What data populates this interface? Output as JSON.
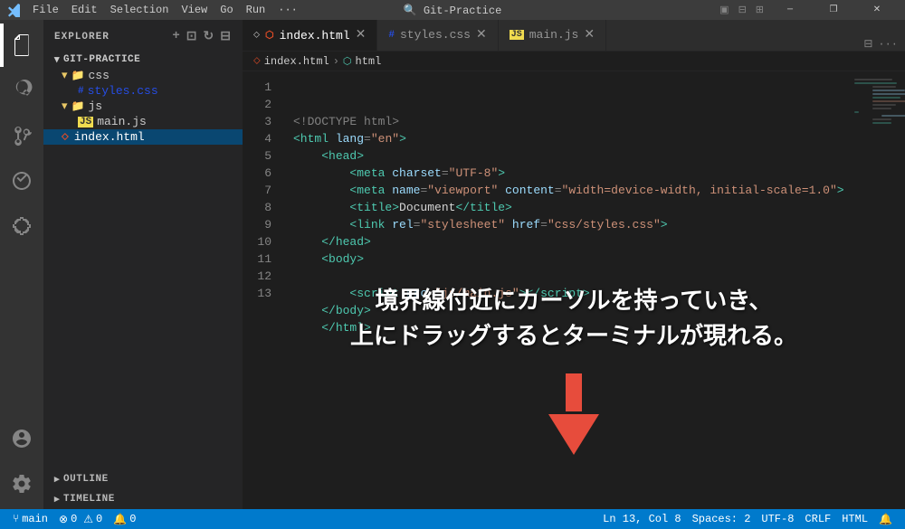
{
  "titlebar": {
    "menu_items": [
      "File",
      "Edit",
      "Selection",
      "View",
      "Go",
      "Run"
    ],
    "more": "···",
    "title": "Git-Practice",
    "search_placeholder": "Git-Practice",
    "btn_minimize": "─",
    "btn_maximize": "□",
    "btn_restore": "❐",
    "btn_close": "✕"
  },
  "activity_bar": {
    "icons": [
      {
        "name": "explorer-icon",
        "symbol": "⎘",
        "label": "Explorer",
        "active": true
      },
      {
        "name": "search-icon",
        "symbol": "🔍",
        "label": "Search"
      },
      {
        "name": "source-control-icon",
        "symbol": "⑂",
        "label": "Source Control"
      },
      {
        "name": "run-icon",
        "symbol": "▷",
        "label": "Run and Debug"
      },
      {
        "name": "extensions-icon",
        "symbol": "⊞",
        "label": "Extensions"
      }
    ],
    "bottom_icons": [
      {
        "name": "account-icon",
        "symbol": "◯",
        "label": "Account"
      },
      {
        "name": "settings-icon",
        "symbol": "⚙",
        "label": "Settings"
      }
    ]
  },
  "sidebar": {
    "header": "EXPLORER",
    "project": {
      "name": "GIT-PRACTICE",
      "folders": [
        {
          "name": "css",
          "expanded": true,
          "files": [
            {
              "name": "styles.css",
              "type": "css"
            }
          ]
        },
        {
          "name": "js",
          "expanded": true,
          "files": [
            {
              "name": "main.js",
              "type": "js"
            }
          ]
        }
      ],
      "files": [
        {
          "name": "index.html",
          "type": "html",
          "selected": true
        }
      ]
    },
    "outline_label": "OUTLINE",
    "timeline_label": "TIMELINE"
  },
  "tabs": [
    {
      "label": "index.html",
      "type": "html",
      "active": true,
      "modified": false
    },
    {
      "label": "styles.css",
      "type": "css",
      "active": false
    },
    {
      "label": "main.js",
      "type": "js",
      "active": false
    }
  ],
  "breadcrumb": {
    "parts": [
      "index.html",
      "html"
    ]
  },
  "code": {
    "lines": [
      {
        "num": 1,
        "html": "<span class='c-meta'>&lt;!DOCTYPE html&gt;</span>"
      },
      {
        "num": 2,
        "html": "<span class='c-tag'>&lt;html</span> <span class='c-attr'>lang</span><span class='c-punct'>=</span><span class='c-str'>\"en\"</span><span class='c-tag'>&gt;</span>"
      },
      {
        "num": 3,
        "html": "    <span class='c-tag'>&lt;head&gt;</span>"
      },
      {
        "num": 4,
        "html": "        <span class='c-tag'>&lt;meta</span> <span class='c-attr'>charset</span><span class='c-punct'>=</span><span class='c-str'>\"UTF-8\"</span><span class='c-tag'>&gt;</span>"
      },
      {
        "num": 5,
        "html": "        <span class='c-tag'>&lt;meta</span> <span class='c-attr'>name</span><span class='c-punct'>=</span><span class='c-str'>\"viewport\"</span> <span class='c-attr'>content</span><span class='c-punct'>=</span><span class='c-str'>\"width=device-width, initial-scale=1.0\"</span><span class='c-tag'>&gt;</span>"
      },
      {
        "num": 6,
        "html": "        <span class='c-tag'>&lt;title&gt;</span><span class='c-text'>Document</span><span class='c-tag'>&lt;/title&gt;</span>"
      },
      {
        "num": 7,
        "html": "        <span class='c-tag'>&lt;link</span> <span class='c-attr'>rel</span><span class='c-punct'>=</span><span class='c-str'>\"stylesheet\"</span> <span class='c-attr'>href</span><span class='c-punct'>=</span><span class='c-str'>\"css/styles.css\"</span><span class='c-tag'>&gt;</span>"
      },
      {
        "num": 8,
        "html": "    <span class='c-tag'>&lt;/head&gt;</span>"
      },
      {
        "num": 9,
        "html": "    <span class='c-tag'>&lt;body&gt;</span>"
      },
      {
        "num": 10,
        "html": ""
      },
      {
        "num": 11,
        "html": "        <span class='c-tag'>&lt;script</span> <span class='c-attr'>src</span><span class='c-punct'>=</span><span class='c-str'>\"js/main.js\"</span><span class='c-tag'>&gt;&lt;/script&gt;</span>"
      },
      {
        "num": 12,
        "html": "    <span class='c-tag'>&lt;/body&gt;</span>"
      },
      {
        "num": 13,
        "html": "    <span class='c-tag'>&lt;/html&gt;</span>"
      }
    ]
  },
  "annotation": {
    "line1": "境界線付近にカーソルを持っていき、",
    "line2": "上にドラッグするとターミナルが現れる。"
  },
  "status_bar": {
    "git_branch": "main",
    "errors": "0",
    "warnings": "0",
    "info_count": "0",
    "position": "Ln 13, Col 8",
    "spaces": "Spaces: 2",
    "encoding": "UTF-8",
    "line_ending": "CRLF",
    "language": "HTML",
    "error_icon": "⊗",
    "warning_icon": "⚠",
    "git_icon": "⑂",
    "bell_icon": "🔔"
  }
}
